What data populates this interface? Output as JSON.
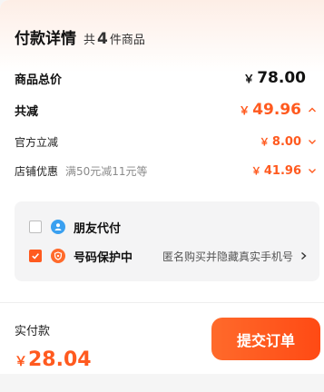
{
  "header": {
    "title": "付款详情",
    "count_prefix": "共",
    "count": "4",
    "count_suffix": "件商品"
  },
  "summary": {
    "total_label": "商品总价",
    "total_currency": "￥",
    "total_value": "78.00",
    "discount_label": "共减",
    "discount_currency": "￥",
    "discount_value": "49.96",
    "official_label": "官方立减",
    "official_currency": "￥",
    "official_value": "8.00",
    "store_label": "店铺优惠",
    "store_detail": "满50元减11元等",
    "store_currency": "￥",
    "store_value": "41.96"
  },
  "options": {
    "friend_pay": {
      "label": "朋友代付",
      "checked": false,
      "icon": "friend-pay-icon"
    },
    "number_protect": {
      "label": "号码保护中",
      "checked": true,
      "icon": "number-protect-icon",
      "detail": "匿名购买并隐藏真实手机号"
    }
  },
  "footer": {
    "pay_label": "实付款",
    "pay_currency": "￥",
    "pay_value": "28.04",
    "submit_label": "提交订单"
  },
  "colors": {
    "accent": "#ff5a1f",
    "friend_icon": "#3aa0f0",
    "protect_icon": "#ff6a2b"
  }
}
